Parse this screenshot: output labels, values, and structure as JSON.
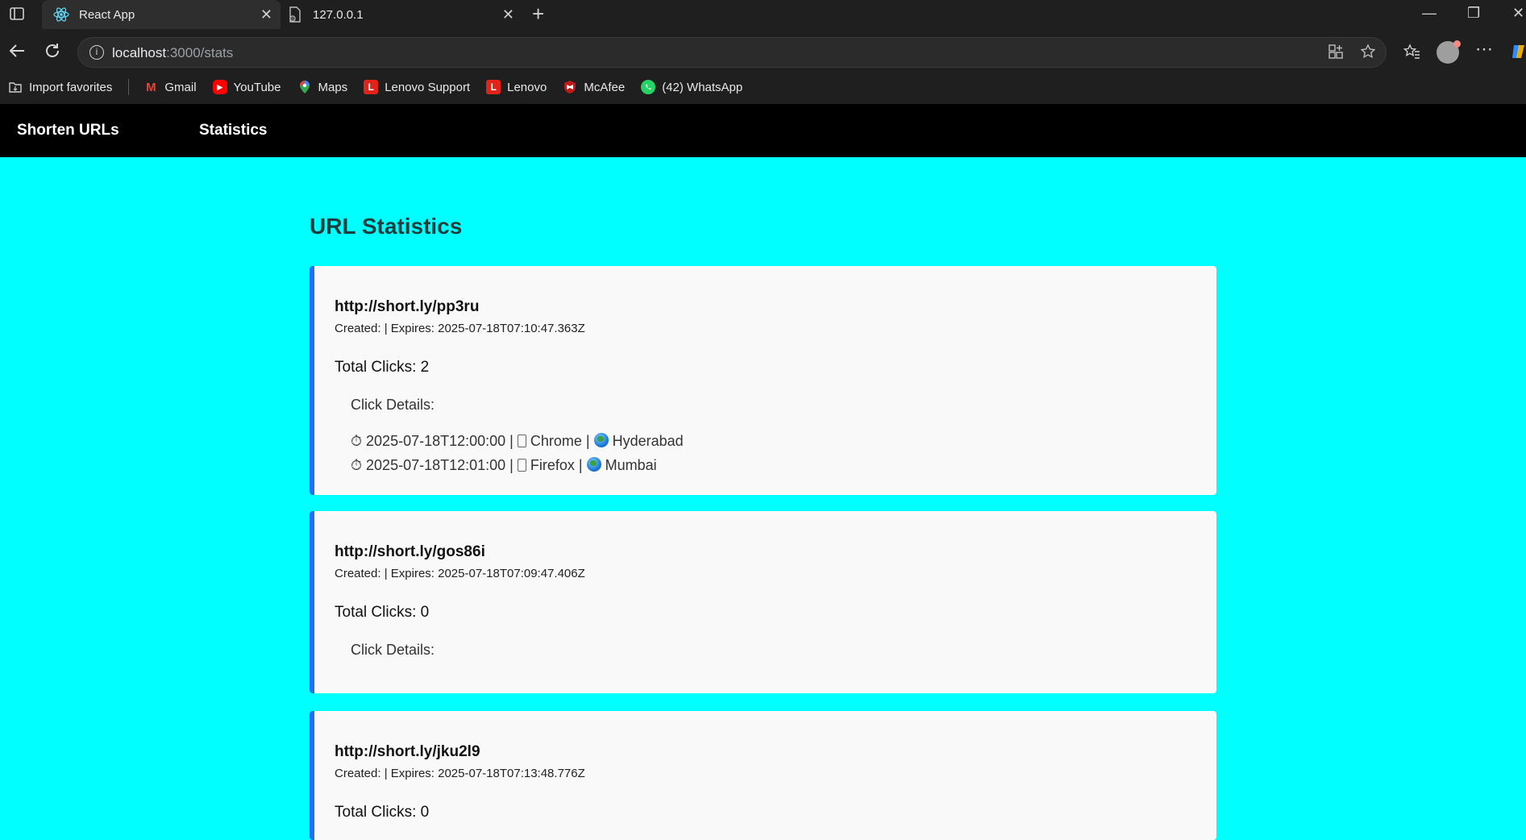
{
  "browser": {
    "tabs": [
      {
        "title": "React App",
        "active": true
      },
      {
        "title": "127.0.0.1",
        "active": false
      }
    ],
    "new_tab_icon": "plus-icon",
    "address": {
      "host": "localhost",
      "path": ":3000/stats"
    },
    "bookmarks": [
      {
        "label": "Import favorites",
        "icon": "import-icon",
        "color": "#cfcfcf"
      },
      {
        "label": "Gmail",
        "icon": "M",
        "color": "#ea4335"
      },
      {
        "label": "YouTube",
        "icon": "▶",
        "color": "#ff0000"
      },
      {
        "label": "Maps",
        "icon": "pin",
        "color": "#34a853"
      },
      {
        "label": "Lenovo Support",
        "icon": "L",
        "color": "#e2231a"
      },
      {
        "label": "Lenovo",
        "icon": "L",
        "color": "#e2231a"
      },
      {
        "label": "McAfee",
        "icon": "M",
        "color": "#c01818"
      },
      {
        "label": "(42) WhatsApp",
        "icon": "W",
        "color": "#25d366"
      }
    ]
  },
  "nav": {
    "shorten": "Shorten URLs",
    "stats": "Statistics"
  },
  "page": {
    "title": "URL Statistics",
    "details_label": "Click Details:",
    "cards": [
      {
        "short_url": "http://short.ly/pp3ru",
        "meta": "Created: | Expires: 2025-07-18T07:10:47.363Z",
        "total": "Total Clicks: 2",
        "clicks": [
          {
            "time": "⏱ 2025-07-18T12:00:00 |",
            "browser": "Chrome |",
            "location": "Hyderabad"
          },
          {
            "time": "⏱ 2025-07-18T12:01:00 |",
            "browser": "Firefox |",
            "location": "Mumbai"
          }
        ]
      },
      {
        "short_url": "http://short.ly/gos86i",
        "meta": "Created: | Expires: 2025-07-18T07:09:47.406Z",
        "total": "Total Clicks: 0",
        "clicks": []
      },
      {
        "short_url": "http://short.ly/jku2l9",
        "meta": "Created: | Expires: 2025-07-18T07:13:48.776Z",
        "total": "Total Clicks: 0",
        "clicks": []
      }
    ]
  },
  "colors": {
    "page_bg": "#00ffff",
    "nav_bg": "#000000",
    "card_bg": "#f9f9f9",
    "card_accent": "#1e6ff5"
  }
}
